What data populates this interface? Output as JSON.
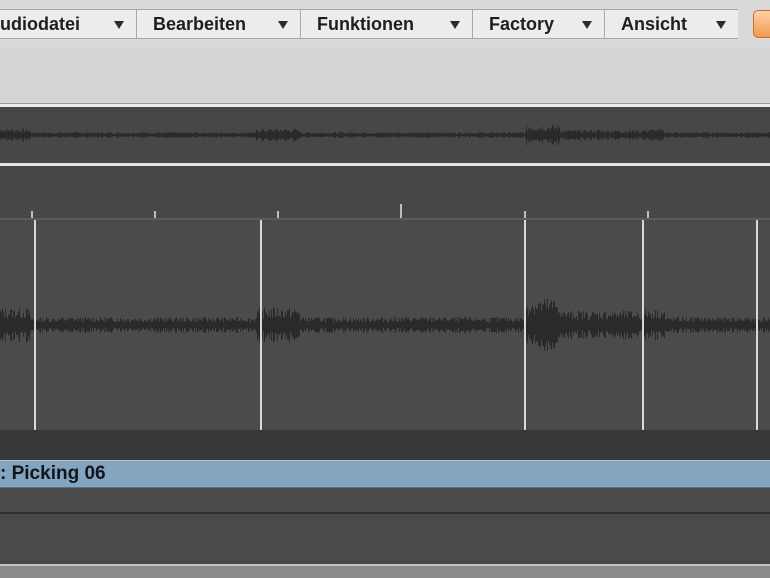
{
  "menubar": {
    "items": [
      {
        "label": "udiodatei"
      },
      {
        "label": "Bearbeiten"
      },
      {
        "label": "Funktionen"
      },
      {
        "label": "Factory"
      },
      {
        "label": "Ansicht"
      }
    ]
  },
  "region": {
    "name": ": Picking 06"
  },
  "colors": {
    "menu_background": "#ececec",
    "editor_background": "#4b4b4b",
    "region_bar": "#84a5c0",
    "waveform": "#2a2a2a",
    "marker_line": "#d8d8d8",
    "accent_button": "#f29a4f"
  }
}
